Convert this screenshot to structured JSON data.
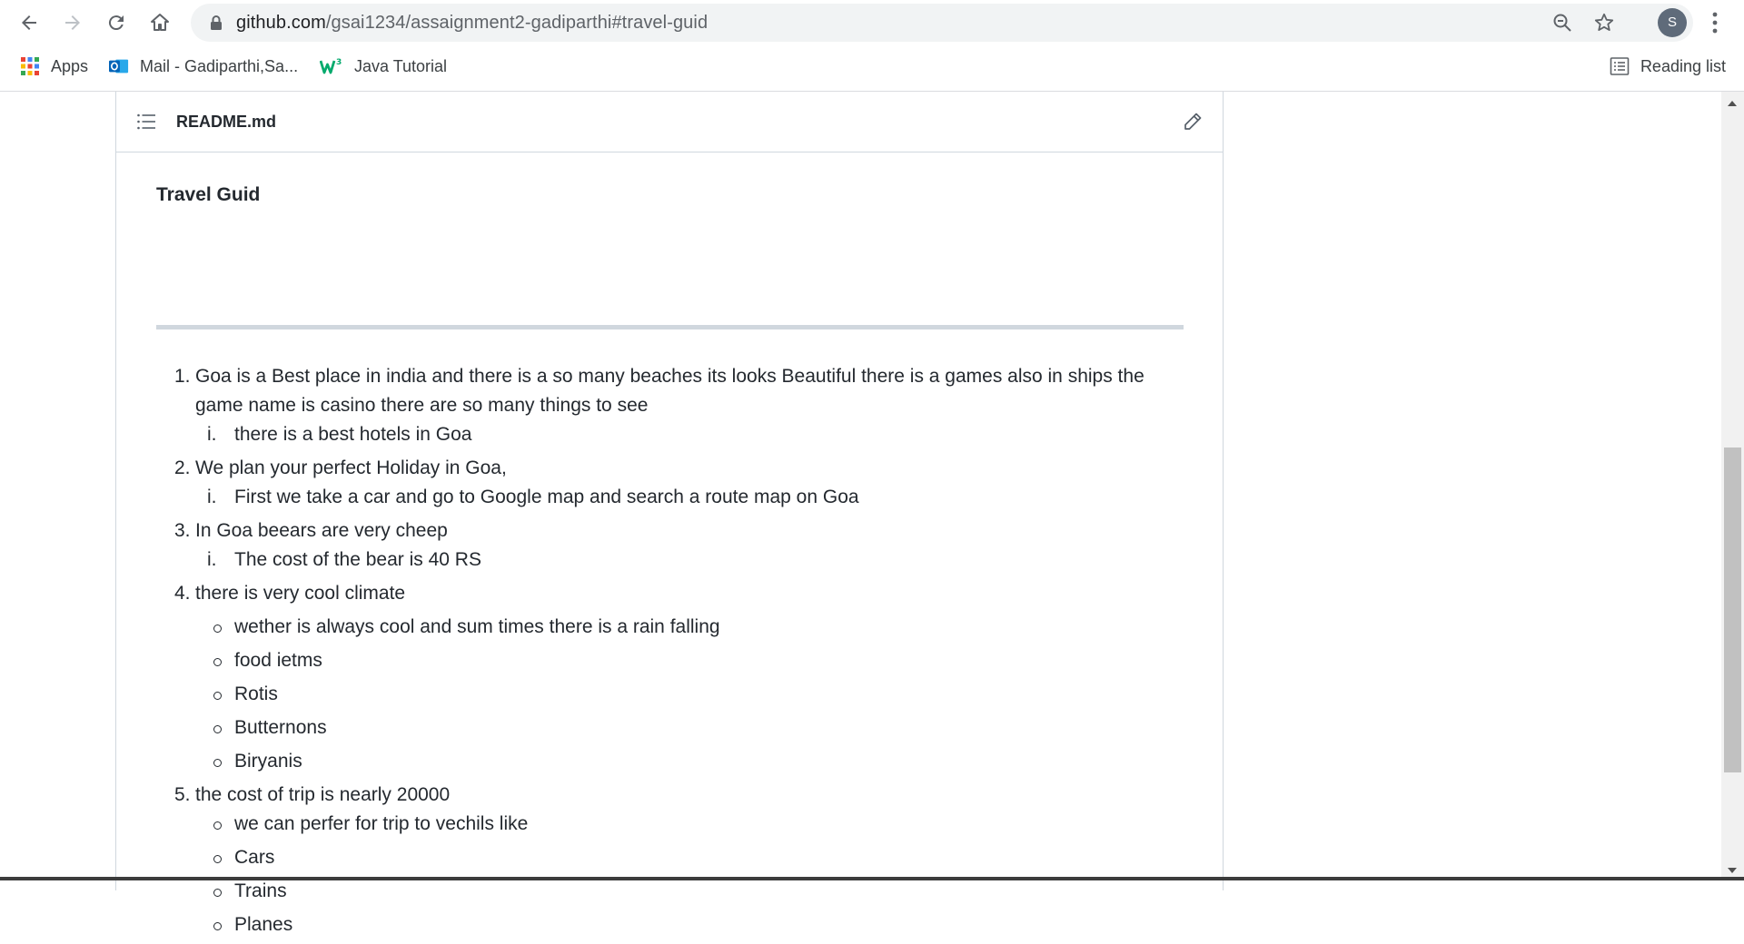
{
  "browser": {
    "url_host": "github.com",
    "url_path": "/gsai1234/assaignment2-gadiparthi#travel-guid",
    "avatar_letter": "S"
  },
  "bookmarks": {
    "apps": "Apps",
    "mail": "Mail - Gadiparthi,Sa...",
    "java": "Java Tutorial",
    "reading_list": "Reading list"
  },
  "file": {
    "name": "README.md"
  },
  "readme": {
    "heading": "Travel Guid",
    "items": [
      {
        "num": "1.",
        "text": "Goa is a Best place in india and there is a so many beaches its looks Beautiful there is a games also in ships the game name is casino there are so many things to see",
        "sub": [
          {
            "marker": "i.",
            "text": "there is a best hotels in Goa"
          }
        ]
      },
      {
        "num": "2.",
        "text": "We plan your perfect Holiday in Goa,",
        "sub": [
          {
            "marker": "i.",
            "text": "First we take a car and go to Google map and search a route map on Goa"
          }
        ]
      },
      {
        "num": "3.",
        "text": "In Goa beears are very cheep",
        "sub": [
          {
            "marker": "i.",
            "text": "The cost of the bear is 40 RS"
          }
        ]
      },
      {
        "num": "4.",
        "text": "there is very cool climate",
        "bullets": [
          "wether is always cool and sum times there is a rain falling",
          "food ietms",
          "Rotis",
          "Butternons",
          "Biryanis"
        ]
      },
      {
        "num": "5.",
        "text": "the cost of trip is nearly 20000",
        "bullets": [
          "we can perfer for trip to vechils like",
          "Cars",
          "Trains",
          "Planes"
        ]
      }
    ]
  },
  "colors": {
    "text": "#24292f",
    "border": "#d0d7de",
    "omnibox": "#f1f3f4"
  }
}
